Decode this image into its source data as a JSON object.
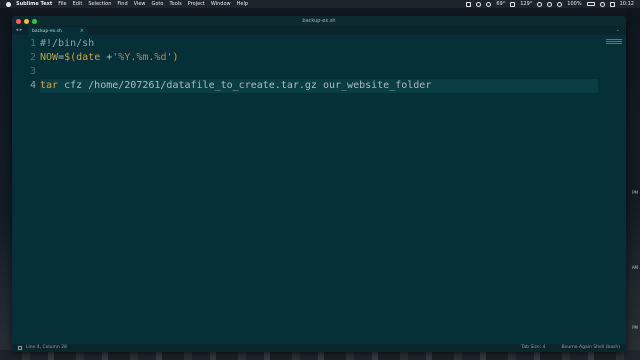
{
  "menubar": {
    "app_name": "Sublime Text",
    "items": [
      "File",
      "Edit",
      "Selection",
      "Find",
      "View",
      "Goto",
      "Tools",
      "Project",
      "Window",
      "Help"
    ],
    "temperature": "69°",
    "cpu": "129°",
    "battery": "100%",
    "time": "10:12"
  },
  "window": {
    "title": "backup-ex.sh",
    "traffic_colors": [
      "#ff5f57",
      "#febc2e",
      "#28c840"
    ]
  },
  "tabs": [
    {
      "label": "backup-ex.sh",
      "active": true
    }
  ],
  "editor": {
    "line_numbers": [
      "1",
      "2",
      "3",
      "4"
    ],
    "active_line": 4,
    "lines": [
      {
        "tokens": [
          {
            "cls": "tok-comment",
            "text": "#!/bin/sh"
          }
        ]
      },
      {
        "tokens": [
          {
            "cls": "tok-var",
            "text": "NOW"
          },
          {
            "cls": "tok-plain",
            "text": "="
          },
          {
            "cls": "tok-kw",
            "text": "$("
          },
          {
            "cls": "tok-cmd",
            "text": "date"
          },
          {
            "cls": "tok-plain",
            "text": " +"
          },
          {
            "cls": "tok-str",
            "text": "'%Y.%m.%d'"
          },
          {
            "cls": "tok-kw",
            "text": ")"
          }
        ]
      },
      {
        "tokens": []
      },
      {
        "tokens": [
          {
            "cls": "tok-cmd",
            "text": "tar"
          },
          {
            "cls": "tok-plain",
            "text": " cfz /home/207261/datafile_to_create.tar.gz our_website_folder"
          }
        ]
      }
    ]
  },
  "statusbar": {
    "position": "Line 4, Column 28",
    "tab_size": "Tab Size: 4",
    "syntax": "Bourne Again Shell (bash)"
  },
  "desktop": {
    "side_labels": [
      "PM",
      "AM",
      "PM"
    ]
  }
}
